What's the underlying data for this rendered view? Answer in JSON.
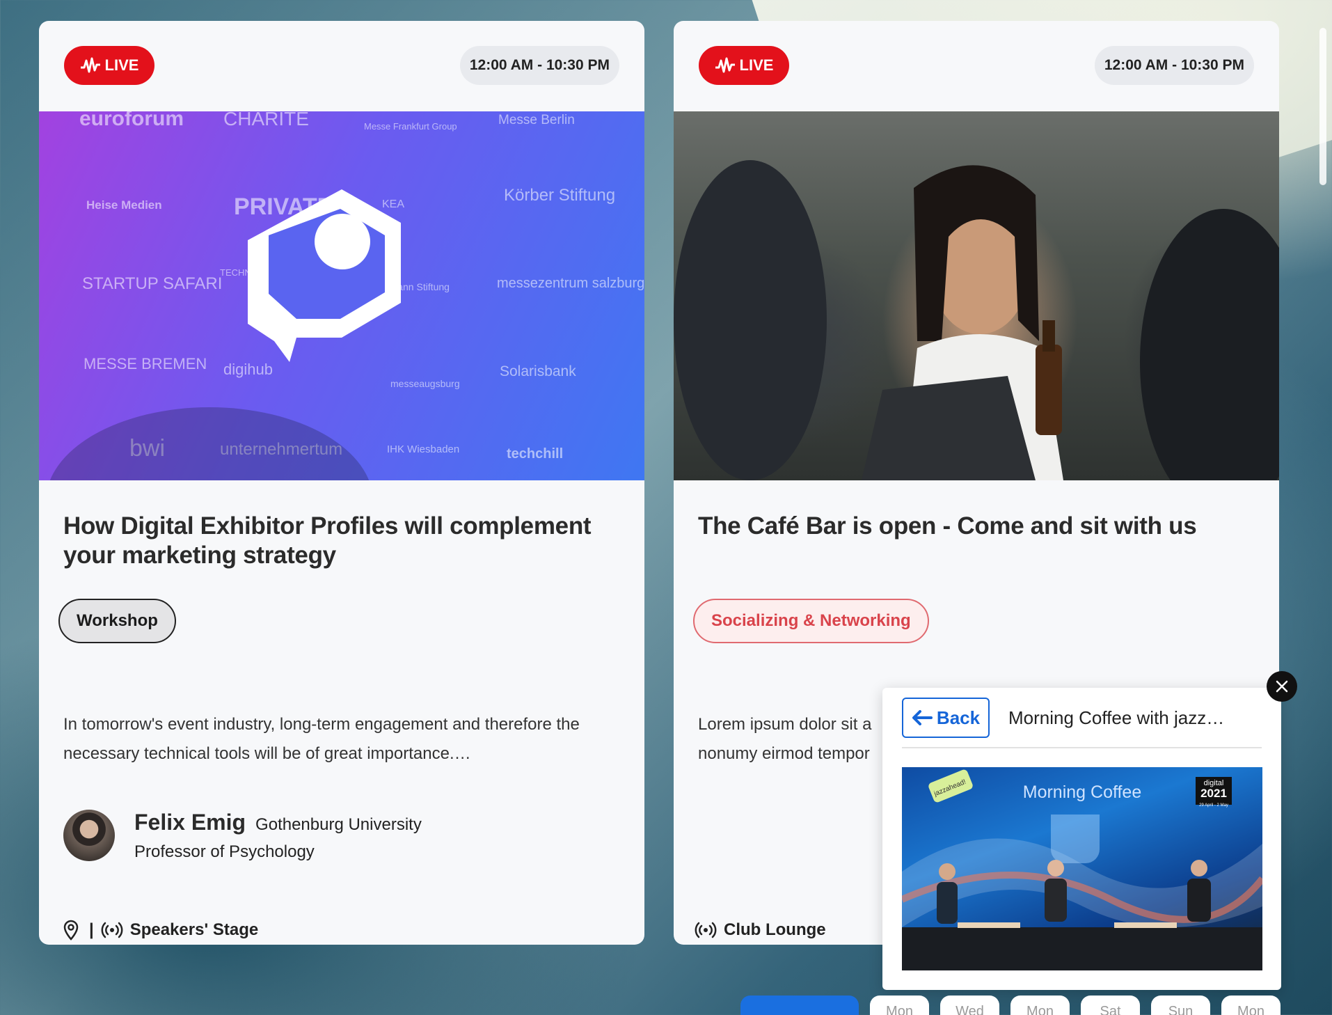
{
  "cards": [
    {
      "live_label": "LIVE",
      "time": "12:00 AM - 10:30 PM",
      "title": "How Digital Exhibitor Profiles will complement your marketing strategy",
      "tag": "Workshop",
      "description": "In tomorrow's event industry, long-term engagement and therefore the necessary technical tools will be of great importance.…",
      "speaker": {
        "name": "Felix Emig",
        "org": "Gothenburg University",
        "role": "Professor of Psychology"
      },
      "location_sep": "|",
      "location": "Speakers' Stage",
      "hero_logos": [
        "euroforum",
        "CHARITÉ",
        "Messe Frankfurt Group",
        "Messe Berlin",
        "Heise Medien",
        "PRIVATEX",
        "KEA",
        "Körber Stiftung",
        "STARTUP SAFARI",
        "TECHNISCHE UNIVERSITÄT DARMSTADT",
        "Bertelsmann Stiftung",
        "messezentrum salzburg",
        "MESSE BREMEN",
        "digihub",
        "messeaugsburg",
        "Solarisbank",
        "bwi",
        "unternehmertum",
        "IHK Wiesbaden",
        "techchill"
      ]
    },
    {
      "live_label": "LIVE",
      "time": "12:00 AM - 10:30 PM",
      "title": "The Café Bar is open - Come and sit with us",
      "tag": "Socializing & Networking",
      "description": "Lorem ipsum dolor sit a nonumy eirmod tempor",
      "location": "Club Lounge"
    }
  ],
  "popup": {
    "back_label": "Back",
    "title": "Morning Coffee with jazz…",
    "video_title": "Morning Coffee",
    "badge_top": "digital",
    "badge_year": "2021",
    "badge_dates": "29 April - 2 May",
    "sticker": "jazzahead!"
  },
  "days": [
    "Mon",
    "Wed",
    "Mon",
    "Sat",
    "Sun",
    "Mon"
  ],
  "colors": {
    "live": "#e3111b",
    "accent": "#1565d8",
    "tag_social": "#d9434b"
  }
}
